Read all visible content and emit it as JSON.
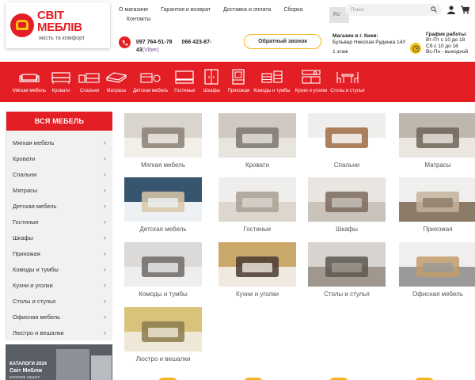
{
  "logo": {
    "title": "СВІТ МЕБЛІВ",
    "subtitle": "якість та комфорт"
  },
  "topnav": {
    "about": "О магазине",
    "warranty": "Гарантия и возврат",
    "delivery": "Доставка и оплата",
    "assembly": "Сборка",
    "contacts": "Контакты"
  },
  "lang": "RU",
  "search": {
    "placeholder": "Поиск"
  },
  "phones": {
    "phone1": "097 764-51-78",
    "phone2": "066 423-87-",
    "phone2_end": "43",
    "viber": "(Viber)"
  },
  "callback": "Обратный звонок",
  "shop": {
    "title": "Магазин в г. Киев:",
    "address": "Бульвар Николая Руденка 14У",
    "floor": "1 этаж"
  },
  "schedule": {
    "title": "График работы:",
    "weekdays": "Вт-Пт с 10 до 18",
    "saturday": "Сб с 10 до 16",
    "offday": "Вс-Пн - выходной"
  },
  "categories": [
    {
      "label": "Мягкая мебель",
      "icon": "sofa-icon"
    },
    {
      "label": "Кровати",
      "icon": "bed-icon"
    },
    {
      "label": "Спальни",
      "icon": "bedroom-icon"
    },
    {
      "label": "Матрасы",
      "icon": "mattress-icon"
    },
    {
      "label": "Детская мебель",
      "icon": "kids-furniture-icon"
    },
    {
      "label": "Гостиные",
      "icon": "living-room-icon"
    },
    {
      "label": "Шкафы",
      "icon": "wardrobe-icon"
    },
    {
      "label": "Прихожая",
      "icon": "hallway-icon"
    },
    {
      "label": "Комоды и тумбы",
      "icon": "dresser-icon"
    },
    {
      "label": "Кухни и уголки",
      "icon": "kitchen-icon"
    },
    {
      "label": "Столы и стулья",
      "icon": "table-chairs-icon"
    }
  ],
  "sidebar": {
    "title": "ВСЯ МЕБЕЛЬ",
    "items": [
      "Мягкая мебель",
      "Кровати",
      "Спальни",
      "Матрасы",
      "Детская мебель",
      "Гостиные",
      "Шкафы",
      "Прихожая",
      "Комоды и тумбы",
      "Кухни и уголки",
      "Столы и стулья",
      "Офисная мебель",
      "Люстро и вешалки"
    ]
  },
  "catalog_banner": {
    "title": "КАТАЛОГИ 2024",
    "brand": "Світ Меблів",
    "sub": "каталоги нашого"
  },
  "products": [
    "Мягкая мебель",
    "Кровати",
    "Спальни",
    "Матрасы",
    "Детская мебель",
    "Гостиные",
    "Шкафы",
    "Прихожая",
    "Комоды и тумбы",
    "Кухни и уголки",
    "Столы и стулья",
    "Офисная мебель",
    "Люстро и вешалки"
  ],
  "colors": {
    "brand_red": "#e31e24",
    "accent_yellow": "#f5b51e"
  }
}
